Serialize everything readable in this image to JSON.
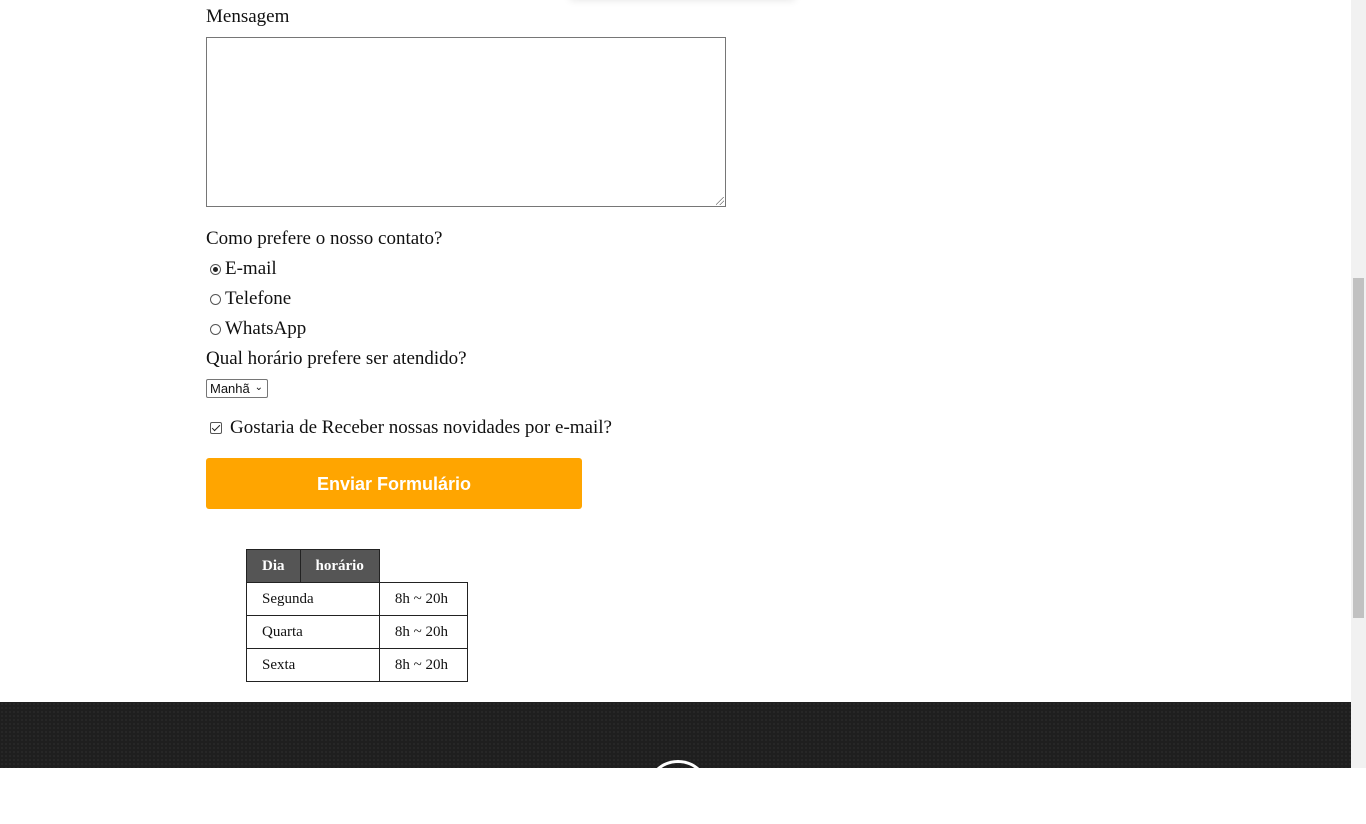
{
  "form": {
    "message_label": "Mensagem",
    "message_value": "",
    "contact_question": "Como prefere o nosso contato?",
    "contact_options": [
      {
        "label": "E-mail",
        "checked": true
      },
      {
        "label": "Telefone",
        "checked": false
      },
      {
        "label": "WhatsApp",
        "checked": false
      }
    ],
    "time_question": "Qual horário prefere ser atendido?",
    "time_selected": "Manhã",
    "newsletter_label": "Gostaria de Receber nossas novidades por e-mail?",
    "newsletter_checked": true,
    "submit_label": "Enviar Formulário"
  },
  "schedule": {
    "headers": [
      "Dia",
      "horário"
    ],
    "rows": [
      {
        "day": "Segunda",
        "time": "8h ~ 20h"
      },
      {
        "day": "Quarta",
        "time": "8h ~ 20h"
      },
      {
        "day": "Sexta",
        "time": "8h ~ 20h"
      }
    ]
  },
  "colors": {
    "accent": "#ffa500",
    "table_header_bg": "#555555",
    "footer_bg": "#1f1f1f"
  },
  "icons": {
    "select_arrow": "chevron-down-icon",
    "checkbox": "checkmark-icon",
    "footer_logo": "logo-icon"
  }
}
